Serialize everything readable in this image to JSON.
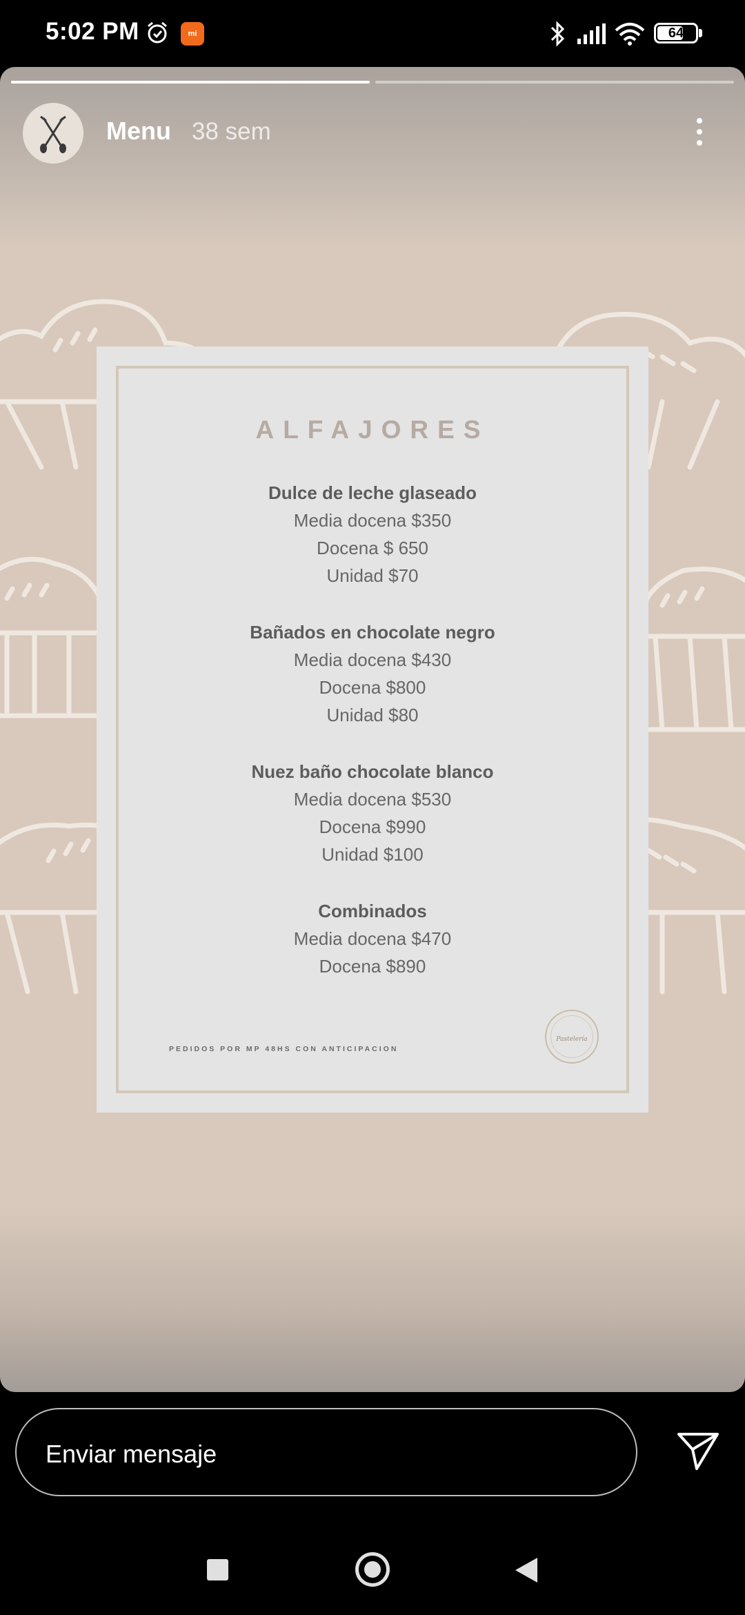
{
  "status_bar": {
    "time": "5:02 PM",
    "icons": [
      "alarm-icon",
      "mi-app-icon",
      "bluetooth-icon",
      "signal-icon",
      "wifi-icon"
    ],
    "battery": "64",
    "mi_label": "mi"
  },
  "story": {
    "progress": [
      1.0,
      0.0
    ],
    "user": "Menu",
    "time_ago": "38 sem",
    "avatar_icon": "crossed-spoons-icon",
    "more_icon": "more-vertical-icon",
    "colors": {
      "background": "#d8c9bc",
      "card": "#e4e4e4",
      "frame": "#d4c7b8",
      "title": "#b6aaa2"
    }
  },
  "menu": {
    "title": "ALFAJORES",
    "sections": [
      {
        "name": "Dulce de leche glaseado",
        "lines": [
          "Media docena $350",
          "Docena $ 650",
          "Unidad $70"
        ]
      },
      {
        "name": "Bañados en chocolate negro",
        "lines": [
          "Media docena $430",
          "Docena $800",
          "Unidad $80"
        ]
      },
      {
        "name": "Nuez  baño chocolate blanco",
        "lines": [
          "Media docena $530",
          "Docena $990",
          "Unidad $100"
        ]
      },
      {
        "name": "Combinados",
        "lines": [
          "Media docena $470",
          "Docena $890"
        ]
      }
    ],
    "footer": "PEDIDOS POR MP 48HS CON ANTICIPACION",
    "logo_text": "Pastelería"
  },
  "message_bar": {
    "placeholder": "Enviar mensaje",
    "send_icon": "send-icon"
  },
  "nav_bar": {
    "icons": [
      "recents-square-icon",
      "home-circle-icon",
      "back-triangle-icon"
    ]
  }
}
